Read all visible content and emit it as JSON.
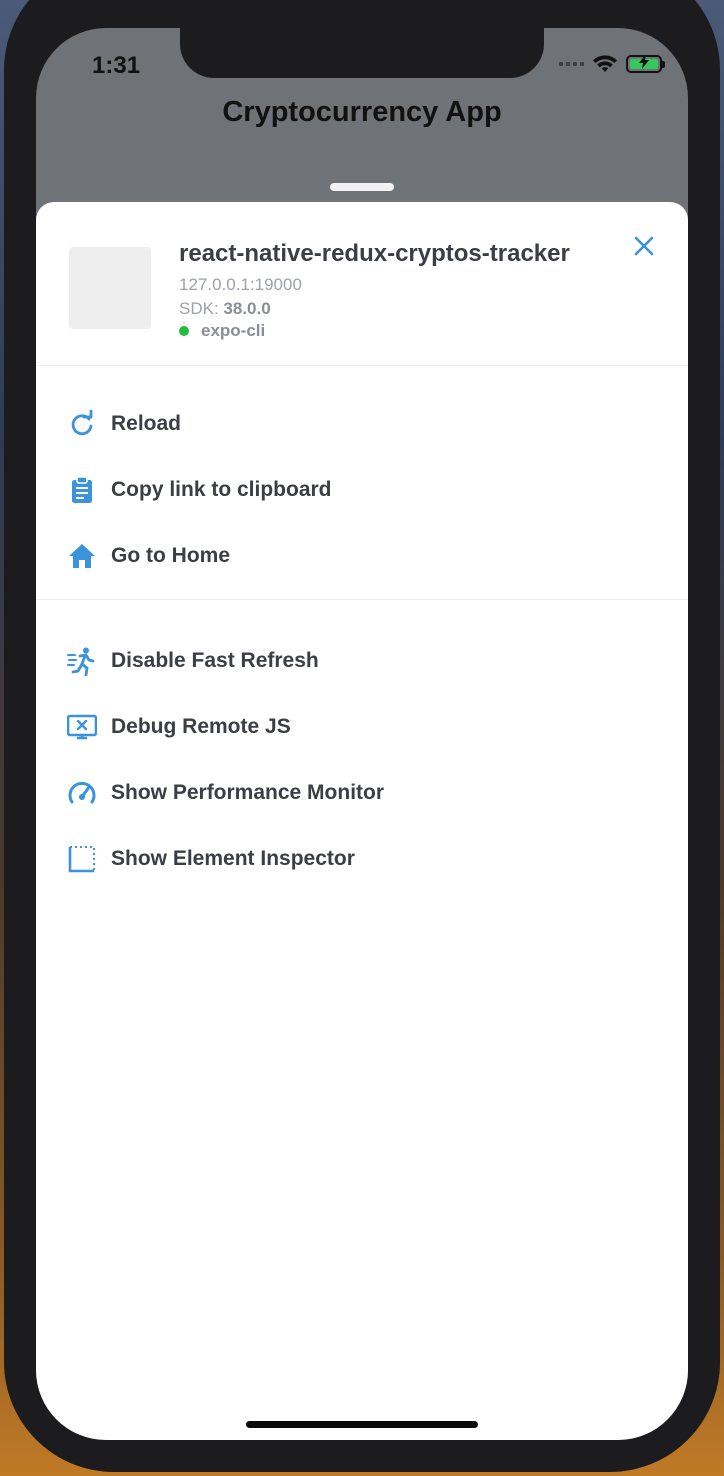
{
  "status_bar": {
    "time": "1:31"
  },
  "app": {
    "title": "Cryptocurrency App"
  },
  "dev_menu": {
    "project_name": "react-native-redux-cryptos-tracker",
    "host": "127.0.0.1:19000",
    "sdk_label": "SDK:",
    "sdk_version": "38.0.0",
    "runtime": "expo-cli",
    "runtime_status_color": "#1fbd3a",
    "accent_color": "#3a93db",
    "close_icon": "close-icon",
    "section_primary": [
      {
        "label": "Reload",
        "icon": "reload-icon"
      },
      {
        "label": "Copy link to clipboard",
        "icon": "clipboard-icon"
      },
      {
        "label": "Go to Home",
        "icon": "home-icon"
      }
    ],
    "section_debug": [
      {
        "label": "Disable Fast Refresh",
        "icon": "running-figure-icon"
      },
      {
        "label": "Debug Remote JS",
        "icon": "remote-debug-monitor-icon"
      },
      {
        "label": "Show Performance Monitor",
        "icon": "speedometer-icon"
      },
      {
        "label": "Show Element Inspector",
        "icon": "inspector-select-icon"
      }
    ]
  }
}
